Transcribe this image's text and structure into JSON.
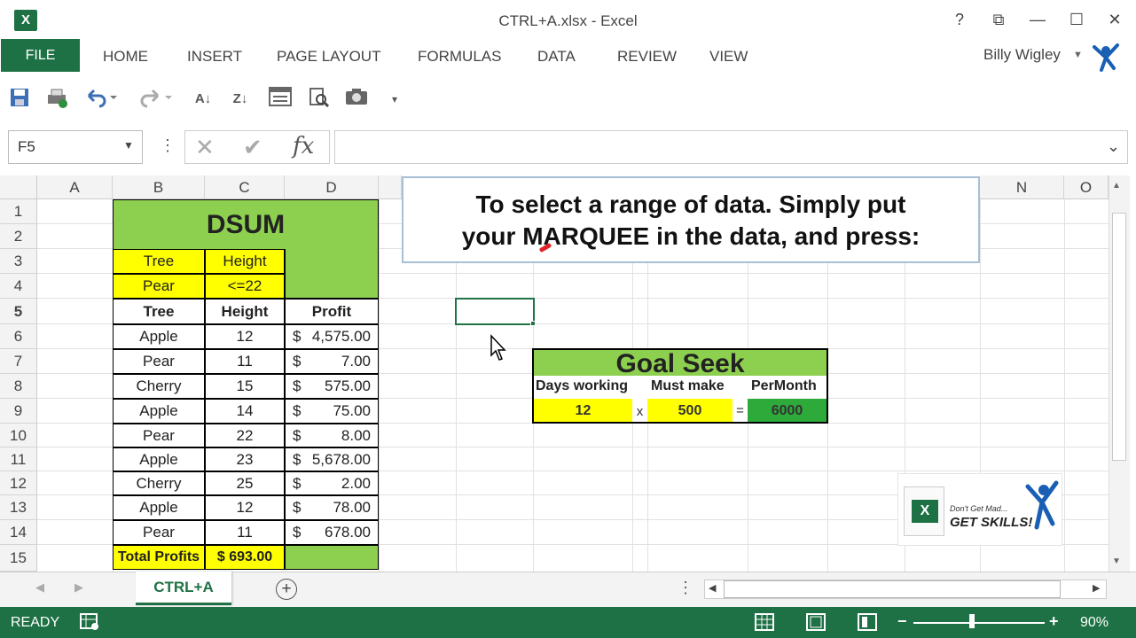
{
  "window": {
    "title": "CTRL+A.xlsx - Excel",
    "app_icon": "X",
    "help": "?",
    "restore_ribbon": "⧉",
    "minimize": "—",
    "maximize": "☐",
    "close": "✕"
  },
  "ribbon": {
    "file": "FILE",
    "tabs": [
      "HOME",
      "INSERT",
      "PAGE LAYOUT",
      "FORMULAS",
      "DATA",
      "REVIEW",
      "VIEW"
    ],
    "user": "Billy Wigley"
  },
  "qat": {
    "icons": [
      "save-icon",
      "print-preview-icon",
      "undo-icon",
      "redo-icon",
      "sort-ascending-icon",
      "sort-descending-icon",
      "form-icon",
      "search-icon",
      "camera-icon",
      "customize-icon"
    ]
  },
  "formula_bar": {
    "name_box": "F5",
    "cancel": "✕",
    "enter": "✔",
    "fx": "fx",
    "value": ""
  },
  "grid": {
    "columns": [
      "A",
      "B",
      "C",
      "D",
      "N",
      "O"
    ],
    "rows": [
      "1",
      "2",
      "3",
      "4",
      "5",
      "6",
      "7",
      "8",
      "9",
      "10",
      "11",
      "12",
      "13",
      "14",
      "15"
    ]
  },
  "dsum": {
    "title": "DSUM",
    "criteria_headers": [
      "Tree",
      "Height"
    ],
    "criteria_values": [
      "Pear",
      "<=22"
    ],
    "headers": [
      "Tree",
      "Height",
      "Profit"
    ],
    "rows": [
      [
        "Apple",
        "12",
        "$",
        "4,575.00"
      ],
      [
        "Pear",
        "11",
        "$",
        "7.00"
      ],
      [
        "Cherry",
        "15",
        "$",
        "575.00"
      ],
      [
        "Apple",
        "14",
        "$",
        "75.00"
      ],
      [
        "Pear",
        "22",
        "$",
        "8.00"
      ],
      [
        "Apple",
        "23",
        "$",
        "5,678.00"
      ],
      [
        "Cherry",
        "25",
        "$",
        "2.00"
      ],
      [
        "Apple",
        "12",
        "$",
        "78.00"
      ],
      [
        "Pear",
        "11",
        "$",
        "678.00"
      ]
    ],
    "total_label": "Total Profits",
    "total_value": "$ 693.00"
  },
  "callout": {
    "line1": "To select a range of data. Simply put",
    "line2": "your MARQUEE in the data, and press:"
  },
  "goal_seek": {
    "title": "Goal Seek",
    "headers": [
      "Days working",
      "Must make",
      "PerMonth"
    ],
    "days": "12",
    "times": "x",
    "must_make": "500",
    "equals": "=",
    "per_month": "6000"
  },
  "logo": {
    "line1": "Don't Get Mad...",
    "line2": "GET SKILLS!"
  },
  "sheets": {
    "active": "CTRL+A",
    "add": "+"
  },
  "status": {
    "mode": "READY",
    "zoom": "90%",
    "zoom_level_percent": 90
  },
  "colors": {
    "excel_green": "#1e7145",
    "header_green": "#8dd050",
    "highlight_yellow": "#ffff00",
    "per_month_green": "#2eaa3a"
  }
}
